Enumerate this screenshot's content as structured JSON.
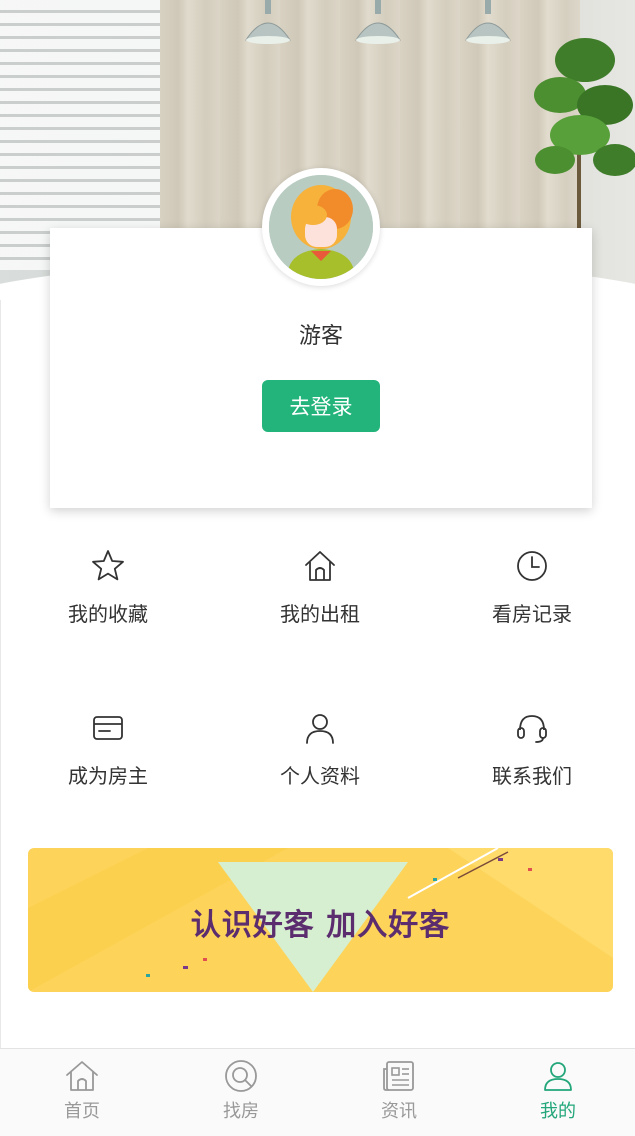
{
  "user": {
    "name": "游客",
    "login_label": "去登录"
  },
  "menu": [
    {
      "label": "我的收藏",
      "icon": "star-icon"
    },
    {
      "label": "我的出租",
      "icon": "house-icon"
    },
    {
      "label": "看房记录",
      "icon": "clock-icon"
    },
    {
      "label": "成为房主",
      "icon": "card-icon"
    },
    {
      "label": "个人资料",
      "icon": "person-icon"
    },
    {
      "label": "联系我们",
      "icon": "headset-icon"
    }
  ],
  "banner": {
    "text": "认识好客 加入好客"
  },
  "tabbar": {
    "active_index": 3,
    "items": [
      {
        "label": "首页",
        "icon": "home-icon"
      },
      {
        "label": "找房",
        "icon": "search-icon"
      },
      {
        "label": "资讯",
        "icon": "news-icon"
      },
      {
        "label": "我的",
        "icon": "user-icon"
      }
    ]
  },
  "colors": {
    "accent": "#22b47b",
    "tab_active": "#22a67a",
    "tab_inactive": "#999999",
    "banner_bg": "#fdd35a",
    "banner_text": "#5b2d6e"
  }
}
